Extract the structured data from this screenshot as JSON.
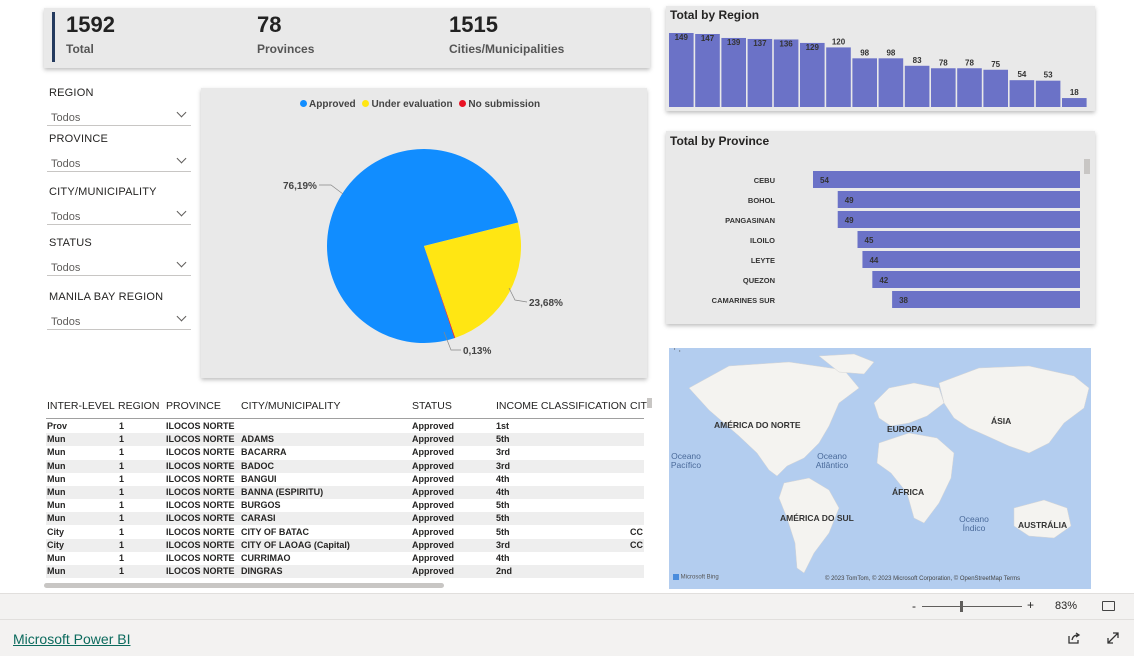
{
  "kpis": [
    {
      "value": "1592",
      "label": "Total"
    },
    {
      "value": "78",
      "label": "Provinces"
    },
    {
      "value": "1515",
      "label": "Cities/Municipalities"
    }
  ],
  "slicers": [
    {
      "title": "REGION",
      "value": "Todos"
    },
    {
      "title": "PROVINCE",
      "value": "Todos"
    },
    {
      "title": "CITY/MUNICIPALITY",
      "value": "Todos"
    },
    {
      "title": "STATUS",
      "value": "Todos"
    },
    {
      "title": "MANILA BAY REGION",
      "value": "Todos"
    }
  ],
  "pie": {
    "legend": [
      {
        "name": "Approved",
        "color": "#118dff"
      },
      {
        "name": "Under evaluation",
        "color": "#ffe613"
      },
      {
        "name": "No submission",
        "color": "#e81123"
      }
    ],
    "labels": [
      "76,19%",
      "23,68%",
      "0,13%"
    ]
  },
  "chart_data": [
    {
      "type": "pie",
      "series": [
        {
          "name": "Approved",
          "value": 76.19
        },
        {
          "name": "Under evaluation",
          "value": 23.68
        },
        {
          "name": "No submission",
          "value": 0.13
        }
      ]
    },
    {
      "type": "bar",
      "title": "Total by Region",
      "values": [
        149,
        147,
        139,
        137,
        136,
        129,
        120,
        98,
        98,
        83,
        78,
        78,
        75,
        54,
        53,
        18
      ],
      "ylim": [
        0,
        149
      ],
      "color": "#6b72c7"
    },
    {
      "type": "bar",
      "title": "Total by Province",
      "categories": [
        "CEBU",
        "BOHOL",
        "PANGASINAN",
        "ILOILO",
        "LEYTE",
        "QUEZON",
        "CAMARINES SUR"
      ],
      "values": [
        54,
        49,
        49,
        45,
        44,
        42,
        38
      ],
      "color": "#6b72c7"
    }
  ],
  "table": {
    "headers": [
      "INTER-LEVEL",
      "REGION",
      "PROVINCE",
      "CITY/MUNICIPALITY",
      "STATUS",
      "INCOME CLASSIFICATION",
      "CIT"
    ],
    "rows": [
      [
        "Prov",
        "1",
        "ILOCOS NORTE",
        "",
        "Approved",
        "1st",
        ""
      ],
      [
        "Mun",
        "1",
        "ILOCOS NORTE",
        "ADAMS",
        "Approved",
        "5th",
        ""
      ],
      [
        "Mun",
        "1",
        "ILOCOS NORTE",
        "BACARRA",
        "Approved",
        "3rd",
        ""
      ],
      [
        "Mun",
        "1",
        "ILOCOS NORTE",
        "BADOC",
        "Approved",
        "3rd",
        ""
      ],
      [
        "Mun",
        "1",
        "ILOCOS NORTE",
        "BANGUI",
        "Approved",
        "4th",
        ""
      ],
      [
        "Mun",
        "1",
        "ILOCOS NORTE",
        "BANNA (ESPIRITU)",
        "Approved",
        "4th",
        ""
      ],
      [
        "Mun",
        "1",
        "ILOCOS NORTE",
        "BURGOS",
        "Approved",
        "5th",
        ""
      ],
      [
        "Mun",
        "1",
        "ILOCOS NORTE",
        "CARASI",
        "Approved",
        "5th",
        ""
      ],
      [
        "City",
        "1",
        "ILOCOS NORTE",
        "CITY OF BATAC",
        "Approved",
        "5th",
        "CC"
      ],
      [
        "City",
        "1",
        "ILOCOS NORTE",
        "CITY OF LAOAG (Capital)",
        "Approved",
        "3rd",
        "CC"
      ],
      [
        "Mun",
        "1",
        "ILOCOS NORTE",
        "CURRIMAO",
        "Approved",
        "4th",
        ""
      ],
      [
        "Mun",
        "1",
        "ILOCOS NORTE",
        "DINGRAS",
        "Approved",
        "2nd",
        ""
      ]
    ]
  },
  "map": {
    "continents": [
      "AMÉRICA DO NORTE",
      "EUROPA",
      "ÁSIA",
      "ÁFRICA",
      "AMÉRICA DO SUL",
      "AUSTRÁLIA"
    ],
    "oceans": [
      "Oceano\nPacífico",
      "Oceano\nAtlântico",
      "Oceano\nÍndico"
    ],
    "attribution": "© 2023 TomTom, © 2023 Microsoft Corporation, © OpenStreetMap  Terms",
    "bing": "Microsoft Bing"
  },
  "zoom": {
    "minus": "-",
    "plus": "+",
    "value": "83%"
  },
  "footer": {
    "link": "Microsoft Power BI"
  }
}
